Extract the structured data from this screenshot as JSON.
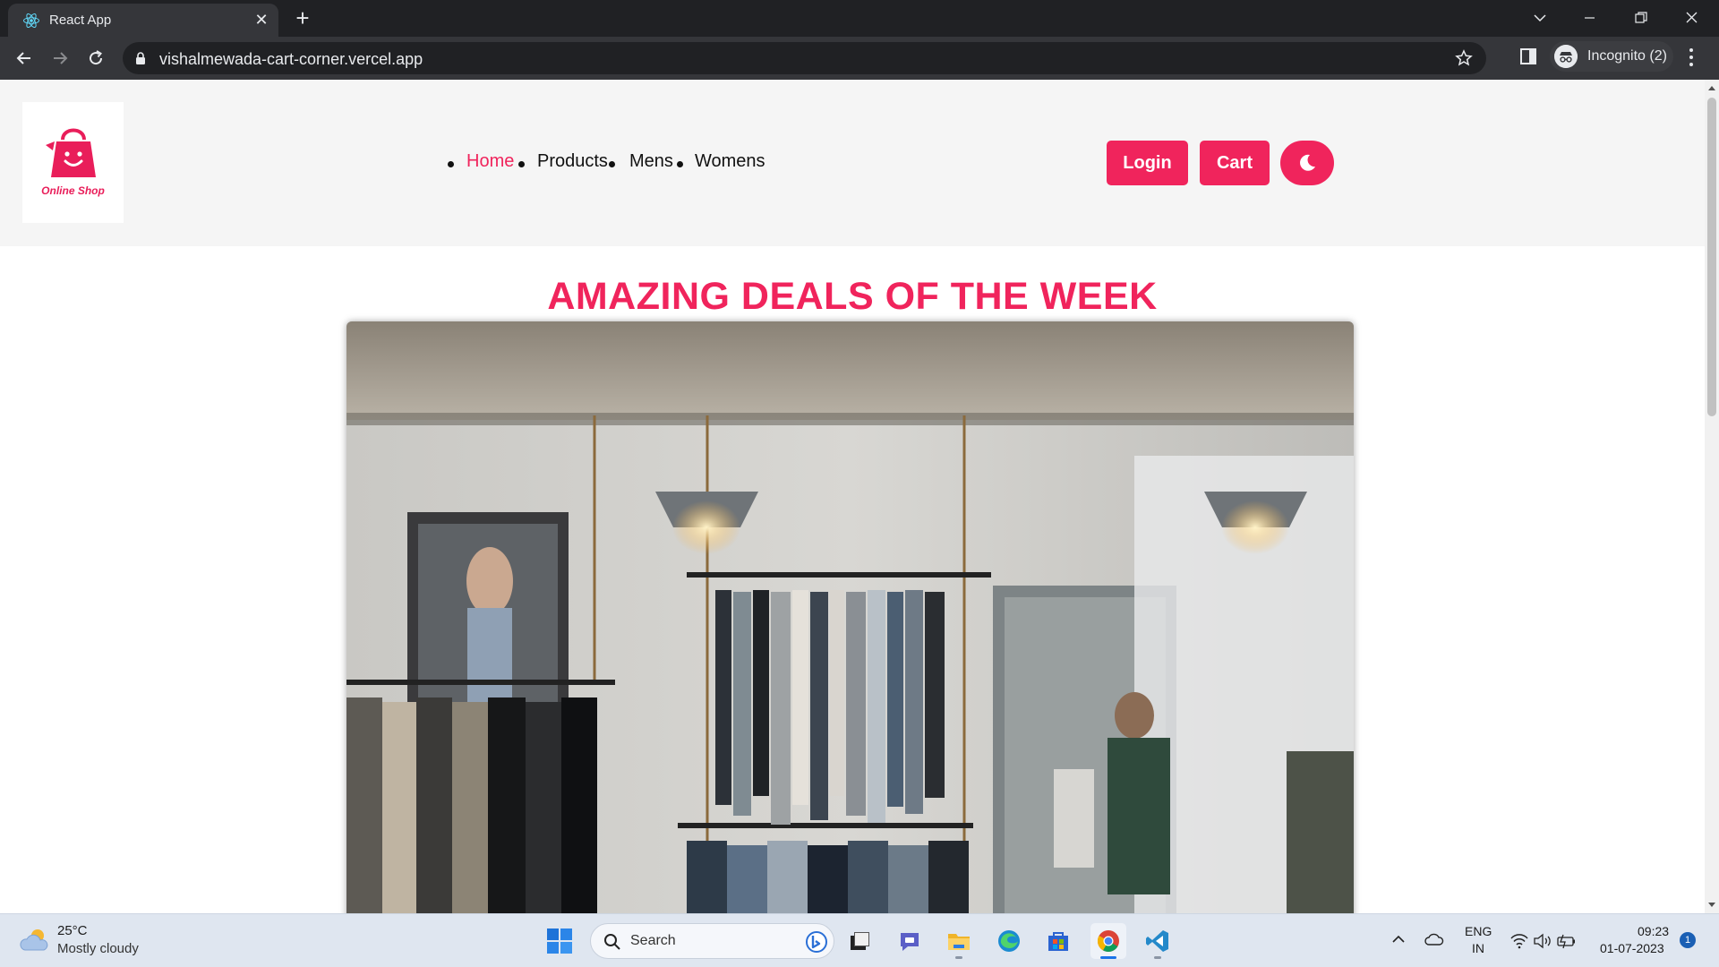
{
  "browser": {
    "tab_title": "React App",
    "tab_close": "✕",
    "new_tab": "+",
    "url": "vishalmewada-cart-corner.vercel.app",
    "profile_label": "Incognito (2)"
  },
  "site": {
    "logo_text": "Online Shop",
    "nav": [
      "Home",
      "Products",
      "Mens",
      "Womens"
    ],
    "active_nav": "Home",
    "buttons": {
      "login": "Login",
      "cart": "Cart"
    },
    "theme_icon": "moon-icon",
    "deals_title": "AMAZING DEALS OF THE WEEK",
    "accent_color": "#f0245c"
  },
  "taskbar": {
    "weather_temp": "25°C",
    "weather_desc": "Mostly cloudy",
    "search_label": "Search",
    "lang_line1": "ENG",
    "lang_line2": "IN",
    "time": "09:23",
    "date": "01-07-2023",
    "notification_count": "1",
    "apps": [
      "task-view-icon",
      "teams-chat-icon",
      "file-explorer-icon",
      "edge-icon",
      "microsoft-store-icon",
      "chrome-icon",
      "vscode-icon"
    ]
  }
}
